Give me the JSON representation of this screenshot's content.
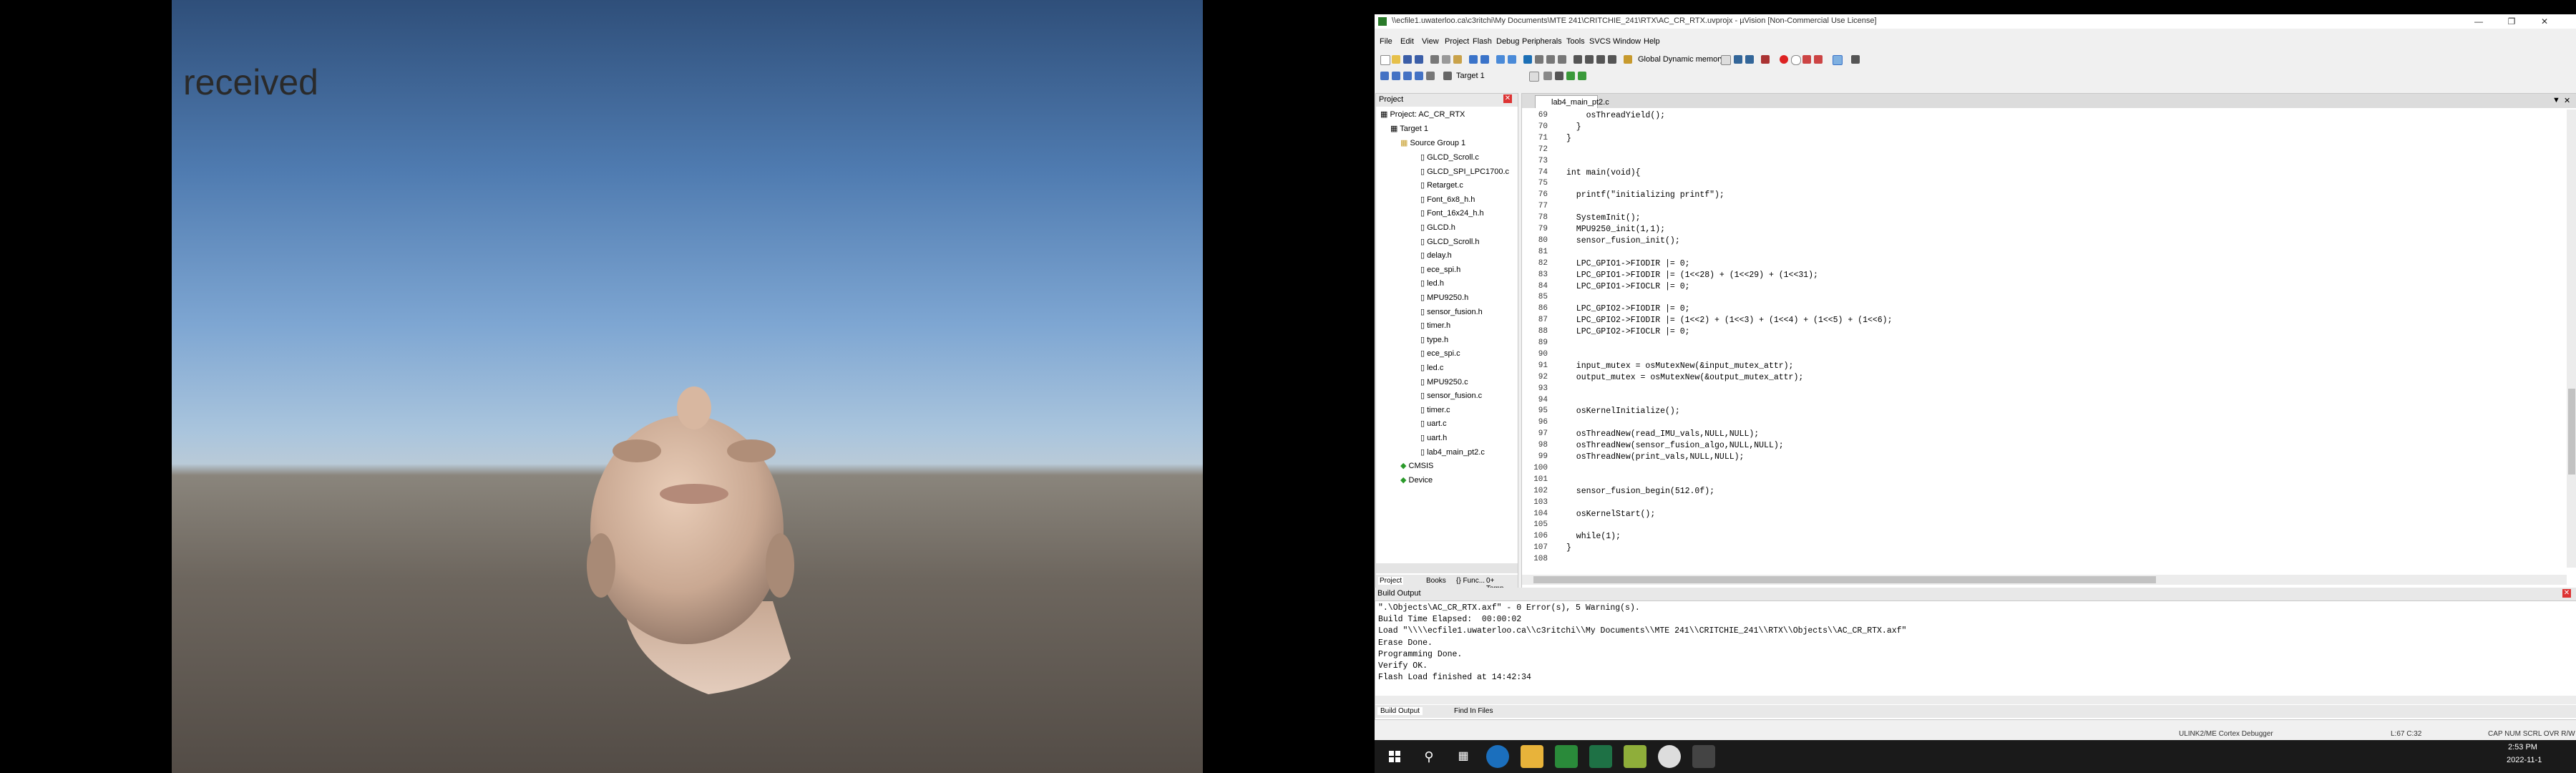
{
  "unity": {
    "overlay_text": "received"
  },
  "window": {
    "title": "\\\\ecfile1.uwaterloo.ca\\c3ritchi\\My Documents\\MTE 241\\CRITCHIE_241\\RTX\\AC_CR_RTX.uvprojx - µVision  [Non-Commercial Use License]",
    "menu": [
      "File",
      "Edit",
      "View",
      "Project",
      "Flash",
      "Debug",
      "Peripherals",
      "Tools",
      "SVCS",
      "Window",
      "Help"
    ],
    "toolbar_combo": "Global Dynamic memory",
    "target_combo": "Target 1",
    "accent": "#1e6fd6"
  },
  "project": {
    "header": "Project",
    "root": "Project: AC_CR_RTX",
    "target": "Target 1",
    "group": "Source Group 1",
    "files": [
      "GLCD_Scroll.c",
      "GLCD_SPI_LPC1700.c",
      "Retarget.c",
      "Font_6x8_h.h",
      "Font_16x24_h.h",
      "GLCD.h",
      "GLCD_Scroll.h",
      "delay.h",
      "ece_spi.h",
      "led.h",
      "MPU9250.h",
      "sensor_fusion.h",
      "timer.h",
      "type.h",
      "ece_spi.c",
      "led.c",
      "MPU9250.c",
      "sensor_fusion.c",
      "timer.c",
      "uart.c",
      "uart.h",
      "lab4_main_pt2.c"
    ],
    "extra": [
      "CMSIS",
      "Device"
    ],
    "bottom_tabs": [
      "Project",
      "Books",
      "{} Func...",
      "0+ Temp..."
    ]
  },
  "editor": {
    "tab": "lab4_main_pt2.c",
    "lines": [
      {
        "n": "69",
        "t": "    osThreadYield();"
      },
      {
        "n": "70",
        "t": "  }"
      },
      {
        "n": "71",
        "t": "}"
      },
      {
        "n": "72",
        "t": ""
      },
      {
        "n": "73",
        "t": ""
      },
      {
        "n": "74",
        "t": "int main(void){"
      },
      {
        "n": "75",
        "t": ""
      },
      {
        "n": "76",
        "t": "  printf(\"initializing printf\");"
      },
      {
        "n": "77",
        "t": ""
      },
      {
        "n": "78",
        "t": "  SystemInit();"
      },
      {
        "n": "79",
        "t": "  MPU9250_init(1,1);"
      },
      {
        "n": "80",
        "t": "  sensor_fusion_init();"
      },
      {
        "n": "81",
        "t": ""
      },
      {
        "n": "82",
        "t": "  LPC_GPIO1->FIODIR |= 0;"
      },
      {
        "n": "83",
        "t": "  LPC_GPIO1->FIODIR |= (1<<28) + (1<<29) + (1<<31);"
      },
      {
        "n": "84",
        "t": "  LPC_GPIO1->FIOCLR |= 0;"
      },
      {
        "n": "85",
        "t": ""
      },
      {
        "n": "86",
        "t": "  LPC_GPIO2->FIODIR |= 0;"
      },
      {
        "n": "87",
        "t": "  LPC_GPIO2->FIODIR |= (1<<2) + (1<<3) + (1<<4) + (1<<5) + (1<<6);"
      },
      {
        "n": "88",
        "t": "  LPC_GPIO2->FIOCLR |= 0;"
      },
      {
        "n": "89",
        "t": ""
      },
      {
        "n": "90",
        "t": ""
      },
      {
        "n": "91",
        "t": "  input_mutex = osMutexNew(&input_mutex_attr);"
      },
      {
        "n": "92",
        "t": "  output_mutex = osMutexNew(&output_mutex_attr);"
      },
      {
        "n": "93",
        "t": ""
      },
      {
        "n": "94",
        "t": ""
      },
      {
        "n": "95",
        "t": "  osKernelInitialize();"
      },
      {
        "n": "96",
        "t": ""
      },
      {
        "n": "97",
        "t": "  osThreadNew(read_IMU_vals,NULL,NULL);"
      },
      {
        "n": "98",
        "t": "  osThreadNew(sensor_fusion_algo,NULL,NULL);"
      },
      {
        "n": "99",
        "t": "  osThreadNew(print_vals,NULL,NULL);"
      },
      {
        "n": "100",
        "t": ""
      },
      {
        "n": "101",
        "t": ""
      },
      {
        "n": "102",
        "t": "  sensor_fusion_begin(512.0f);"
      },
      {
        "n": "103",
        "t": ""
      },
      {
        "n": "104",
        "t": "  osKernelStart();"
      },
      {
        "n": "105",
        "t": ""
      },
      {
        "n": "106",
        "t": "  while(1);"
      },
      {
        "n": "107",
        "t": "}"
      },
      {
        "n": "108",
        "t": ""
      }
    ]
  },
  "build": {
    "header": "Build Output",
    "lines": [
      "\".\\Objects\\AC_CR_RTX.axf\" - 0 Error(s), 5 Warning(s).",
      "Build Time Elapsed:  00:00:02",
      "Load \"\\\\\\\\ecfile1.uwaterloo.ca\\\\c3ritchi\\\\My Documents\\\\MTE 241\\\\CRITCHIE_241\\\\RTX\\\\Objects\\\\AC_CR_RTX.axf\"",
      "Erase Done.",
      "Programming Done.",
      "Verify OK.",
      "Flash Load finished at 14:42:34"
    ],
    "tabs": [
      "Build Output",
      "Find In Files"
    ]
  },
  "status": {
    "debugger": "ULINK2/ME Cortex Debugger",
    "position": "L:67 C:32",
    "flags": "CAP  NUM  SCRL  OVR  R/W"
  },
  "taskbar": {
    "time": "2:53 PM",
    "date": "2022-11-1"
  }
}
